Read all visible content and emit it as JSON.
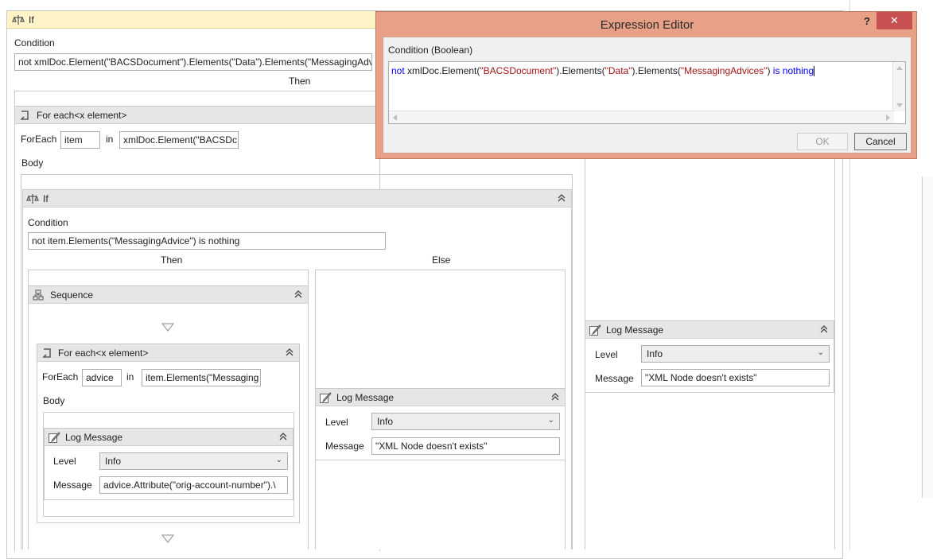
{
  "outer_if": {
    "title": "If",
    "condition_label": "Condition",
    "condition_value": "not xmlDoc.Element(\"BACSDocument\").Elements(\"Data\").Elements(\"MessagingAdv",
    "then_label": "Then"
  },
  "foreach_outer": {
    "title": "For each<x element>",
    "foreach_label": "ForEach",
    "item_value": "item",
    "in_label": "in",
    "collection_value": "xmlDoc.Element(\"BACSDc",
    "body_label": "Body"
  },
  "inner_if": {
    "title": "If",
    "condition_label": "Condition",
    "condition_value": "not item.Elements(\"MessagingAdvice\") is nothing",
    "then_label": "Then",
    "else_label": "Else"
  },
  "sequence": {
    "title": "Sequence"
  },
  "foreach_inner": {
    "title": "For each<x element>",
    "foreach_label": "ForEach",
    "item_value": "advice",
    "in_label": "in",
    "collection_value": "item.Elements(\"Messaging",
    "body_label": "Body"
  },
  "log_inner": {
    "title": "Log Message",
    "level_label": "Level",
    "level_value": "Info",
    "message_label": "Message",
    "message_value": "advice.Attribute(\"orig-account-number\").\\"
  },
  "log_else": {
    "title": "Log Message",
    "level_label": "Level",
    "level_value": "Info",
    "message_label": "Message",
    "message_value": "\"XML Node doesn't exists\""
  },
  "log_right": {
    "title": "Log Message",
    "level_label": "Level",
    "level_value": "Info",
    "message_label": "Message",
    "message_value": "\"XML Node doesn't exists\""
  },
  "dialog": {
    "title": "Expression Editor",
    "help": "?",
    "close": "✕",
    "field_label": "Condition (Boolean)",
    "expr_kw1": "not",
    "expr_part1": " xmlDoc.Element(",
    "expr_str1": "\"BACSDocument\"",
    "expr_part2": ").Elements(",
    "expr_str2": "\"Data\"",
    "expr_part3": ").Elements(",
    "expr_str3": "\"MessagingAdvices\"",
    "expr_part4": ") ",
    "expr_kw2": "is nothing",
    "ok_label": "OK",
    "cancel_label": "Cancel"
  },
  "colors": {
    "dialog_frame": "#e8a086",
    "outer_if_header": "#fff4c7",
    "keyword": "#0000ff",
    "string": "#a31515"
  },
  "icons": [
    "if-icon",
    "foreach-icon",
    "sequence-icon",
    "log-message-icon",
    "collapse-icon",
    "drop-arrow-icon",
    "dropdown-chevron-icon"
  ]
}
